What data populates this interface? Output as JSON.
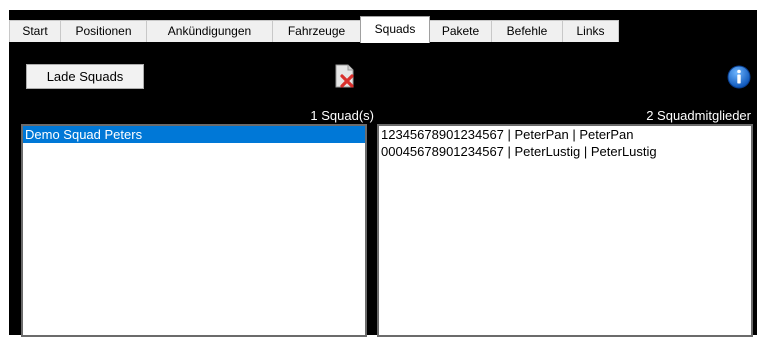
{
  "tabs": [
    {
      "label": "Start",
      "active": false
    },
    {
      "label": "Positionen",
      "active": false
    },
    {
      "label": "Ankündigungen",
      "active": false
    },
    {
      "label": "Fahrzeuge",
      "active": false
    },
    {
      "label": "Squads",
      "active": true
    },
    {
      "label": "Pakete",
      "active": false
    },
    {
      "label": "Befehle",
      "active": false
    },
    {
      "label": "Links",
      "active": false
    }
  ],
  "toolbar": {
    "load_button": "Lade Squads",
    "delete_icon": "delete-squad-icon",
    "info_icon": "info-icon"
  },
  "squads": {
    "count_label": "1 Squad(s)",
    "items": [
      "Demo Squad Peters"
    ],
    "selected_index": 0
  },
  "members": {
    "count_label": "2 Squadmitglieder",
    "items": [
      "12345678901234567 | PeterPan | PeterPan",
      "00045678901234567 | PeterLustig | PeterLustig"
    ]
  },
  "colors": {
    "background": "#000000",
    "selection": "#0078d7",
    "info_blue": "#1a6fd0",
    "delete_red": "#d9302c"
  }
}
